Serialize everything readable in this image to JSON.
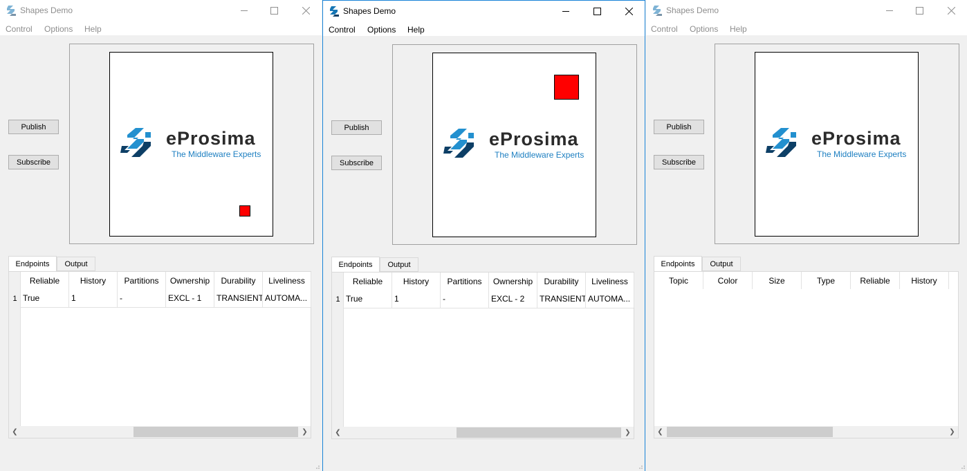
{
  "windows": [
    {
      "title": "Shapes Demo",
      "state": "inactive",
      "menu": [
        "Control",
        "Options",
        "Help"
      ],
      "buttons": {
        "publish": "Publish",
        "subscribe": "Subscribe"
      },
      "logo": {
        "word": "eProsima",
        "tagline": "The Middleware Experts"
      },
      "shape": {
        "color": "#ff0000",
        "kind": "square"
      },
      "tabs": [
        "Endpoints",
        "Output"
      ],
      "columns": [
        "Reliable",
        "History",
        "Partitions",
        "Ownership",
        "Durability",
        "Liveliness"
      ],
      "rows": [
        {
          "num": "1",
          "cells": [
            "True",
            "1",
            "-",
            "EXCL - 1",
            "TRANSIENT",
            "AUTOMA..."
          ]
        }
      ]
    },
    {
      "title": "Shapes Demo",
      "state": "active",
      "menu": [
        "Control",
        "Options",
        "Help"
      ],
      "buttons": {
        "publish": "Publish",
        "subscribe": "Subscribe"
      },
      "logo": {
        "word": "eProsima",
        "tagline": "The Middleware Experts"
      },
      "shape": {
        "color": "#ff0000",
        "kind": "square"
      },
      "tabs": [
        "Endpoints",
        "Output"
      ],
      "columns": [
        "Reliable",
        "History",
        "Partitions",
        "Ownership",
        "Durability",
        "Liveliness"
      ],
      "rows": [
        {
          "num": "1",
          "cells": [
            "True",
            "1",
            "-",
            "EXCL - 2",
            "TRANSIENT",
            "AUTOMA..."
          ]
        }
      ]
    },
    {
      "title": "Shapes Demo",
      "state": "inactive",
      "menu": [
        "Control",
        "Options",
        "Help"
      ],
      "buttons": {
        "publish": "Publish",
        "subscribe": "Subscribe"
      },
      "logo": {
        "word": "eProsima",
        "tagline": "The Middleware Experts"
      },
      "tabs": [
        "Endpoints",
        "Output"
      ],
      "columns": [
        "Topic",
        "Color",
        "Size",
        "Type",
        "Reliable",
        "History"
      ],
      "rows": []
    }
  ],
  "colors": {
    "accent_border": "#1883d7",
    "shape_red": "#ff0000",
    "logo_blue": "#1d7fc1"
  },
  "icons": [
    "app-icon",
    "minimize-icon",
    "maximize-icon",
    "close-icon",
    "eprosima-logo-mark",
    "scroll-left-icon",
    "scroll-right-icon",
    "resize-grip-icon"
  ]
}
